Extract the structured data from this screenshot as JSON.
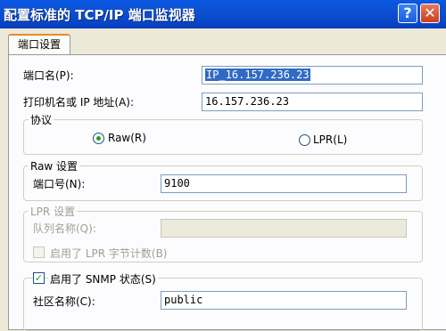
{
  "window": {
    "title": "配置标准的 TCP/IP 端口监视器",
    "help_glyph": "?",
    "close_glyph": "✕"
  },
  "tabs": [
    {
      "label": "端口设置"
    }
  ],
  "port_name": {
    "label": "端口名(P):",
    "value": "IP_16.157.236.23"
  },
  "printer_address": {
    "label": "打印机名或 IP 地址(A):",
    "value": "16.157.236.23"
  },
  "protocol": {
    "legend": "协议",
    "raw_label": "Raw(R)",
    "lpr_label": "LPR(L)",
    "selected": "Raw"
  },
  "raw_settings": {
    "legend": "Raw 设置",
    "port_number_label": "端口号(N):",
    "port_number_value": "9100"
  },
  "lpr_settings": {
    "legend": "LPR 设置",
    "queue_name_label": "队列名称(Q):",
    "queue_name_value": "",
    "byte_count_label": "启用了 LPR 字节计数(B)",
    "byte_count_checked": false
  },
  "snmp": {
    "label": "启用了 SNMP 状态(S)",
    "checked": true,
    "check_glyph": "✓",
    "community_label": "社区名称(C):",
    "community_value": "public"
  }
}
